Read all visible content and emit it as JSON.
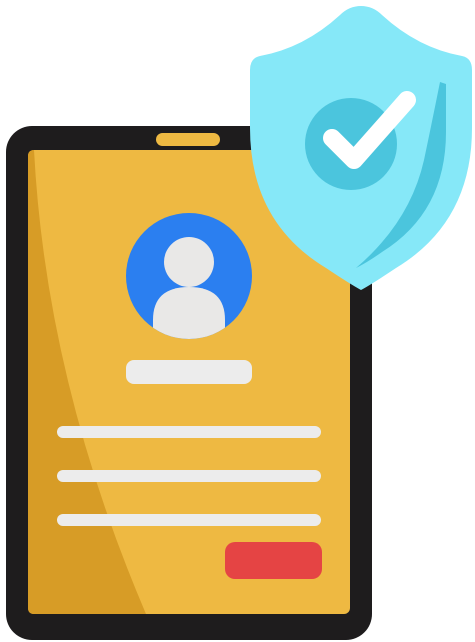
{
  "illustration": {
    "subject": "tablet-with-profile-and-security-shield",
    "icons": [
      "tablet-icon",
      "user-avatar-icon",
      "shield-icon",
      "checkmark-icon"
    ]
  },
  "colors": {
    "tablet_frame": "#1e1c1d",
    "screen_fill": "#eeb942",
    "screen_shade": "#d79c26",
    "camera_slot": "#eeb942",
    "avatar_circle": "#2b7ff0",
    "avatar_figure": "#e9e8e7",
    "placeholder_bar": "#ececec",
    "action_button": "#e54444",
    "shield_outer": "#86e8f8",
    "shield_inner": "#4bc5dd",
    "check_circle": "#4bc5dd",
    "checkmark": "#ffffff"
  },
  "profile_form": {
    "text_line_count": 3
  }
}
